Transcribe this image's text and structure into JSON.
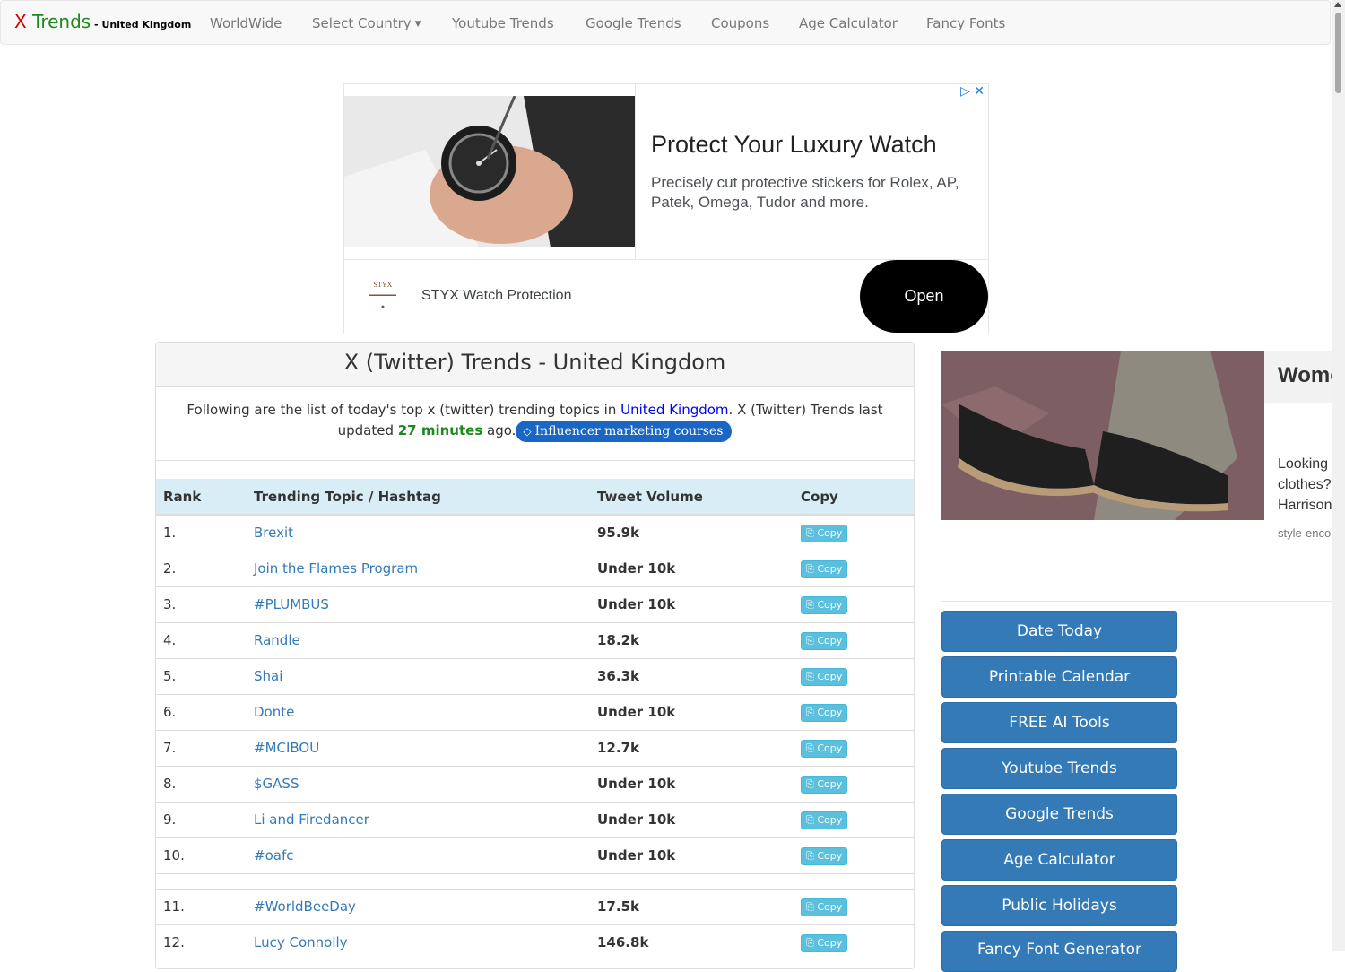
{
  "nav": {
    "brand_x": "X",
    "brand_trends": "Trends",
    "brand_sub": " - United Kingdom",
    "items": [
      "WorldWide",
      "Select Country",
      "Youtube Trends",
      "Google Trends",
      "Coupons",
      "Age Calculator",
      "Fancy Fonts"
    ]
  },
  "ad_top": {
    "headline": "Protect Your Luxury Watch",
    "description": "Precisely cut protective stickers for Rolex, AP, Patek, Omega, Tudor and more.",
    "logo_text": "STYX",
    "advertiser": "STYX Watch Protection",
    "cta": "Open"
  },
  "panel": {
    "title": "X (Twitter) Trends - United Kingdom",
    "intro_pre": "Following are the list of today's top x (twitter) trending topics in ",
    "country_link": "United Kingdom",
    "intro_mid": ". X (Twitter) Trends last updated ",
    "minutes": "27 minutes",
    "intro_post": " ago.",
    "tag_label": "Influencer marketing courses"
  },
  "table": {
    "headers": [
      "Rank",
      "Trending Topic / Hashtag",
      "Tweet Volume",
      "Copy"
    ],
    "copy_label": "Copy",
    "rows": [
      {
        "rank": "1.",
        "topic": "Brexit",
        "volume": "95.9k"
      },
      {
        "rank": "2.",
        "topic": "Join the Flames Program",
        "volume": "Under 10k"
      },
      {
        "rank": "3.",
        "topic": "#PLUMBUS",
        "volume": "Under 10k"
      },
      {
        "rank": "4.",
        "topic": "Randle",
        "volume": "18.2k"
      },
      {
        "rank": "5.",
        "topic": "Shai",
        "volume": "36.3k"
      },
      {
        "rank": "6.",
        "topic": "Donte",
        "volume": "Under 10k"
      },
      {
        "rank": "7.",
        "topic": "#MCIBOU",
        "volume": "12.7k"
      },
      {
        "rank": "8.",
        "topic": "$GASS",
        "volume": "Under 10k"
      },
      {
        "rank": "9.",
        "topic": "Li and Firedancer",
        "volume": "Under 10k"
      },
      {
        "rank": "10.",
        "topic": "#oafc",
        "volume": "Under 10k"
      },
      {
        "rank": "11.",
        "topic": "#WorldBeeDay",
        "volume": "17.5k"
      },
      {
        "rank": "12.",
        "topic": "Lucy Connolly",
        "volume": "146.8k"
      }
    ]
  },
  "ad_right": {
    "headline": "Wome",
    "body_lines": [
      "Looking",
      "clothes?",
      "Harrison"
    ],
    "source": "style-enco"
  },
  "sidebar": {
    "buttons": [
      "Date Today",
      "Printable Calendar",
      "FREE AI Tools",
      "Youtube Trends",
      "Google Trends",
      "Age Calculator",
      "Public Holidays",
      "Fancy Font Generator"
    ]
  }
}
